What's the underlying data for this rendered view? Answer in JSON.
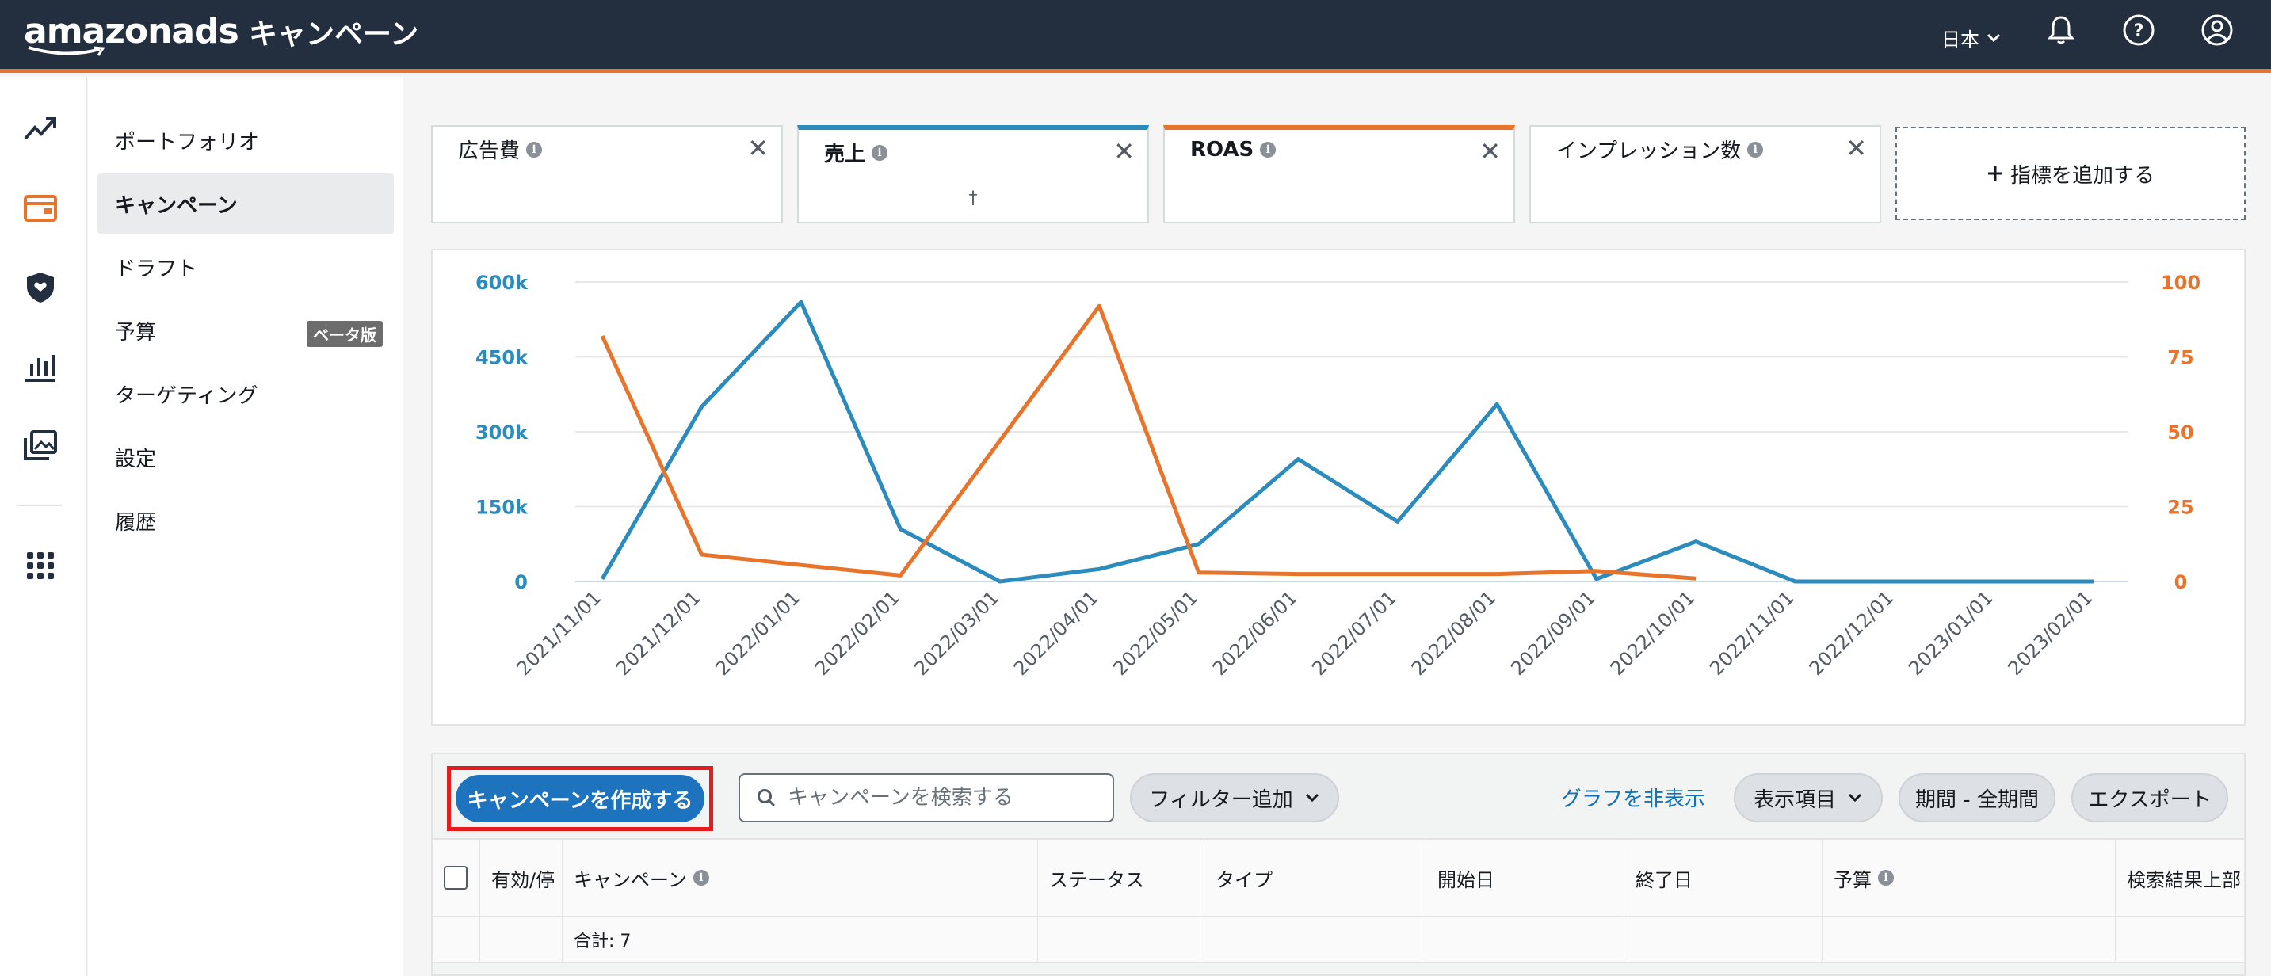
{
  "header": {
    "logo": "amazonads",
    "title": "キャンペーン",
    "language": "日本",
    "icons": [
      "bell-icon",
      "help-icon",
      "account-icon"
    ]
  },
  "rail": {
    "icons": [
      "trend-icon",
      "campaign-icon",
      "shield-icon",
      "bar-chart-icon",
      "media-icon",
      "apps-grid-icon"
    ]
  },
  "sidebar": {
    "items": [
      {
        "label": "ポートフォリオ"
      },
      {
        "label": "キャンペーン"
      },
      {
        "label": "ドラフト"
      },
      {
        "label": "予算",
        "badge": "ベータ版"
      },
      {
        "label": "ターゲティング"
      },
      {
        "label": "設定"
      },
      {
        "label": "履歴"
      }
    ]
  },
  "metrics": {
    "cards": [
      {
        "label": "広告費",
        "value": ""
      },
      {
        "label": "売上",
        "value": "†"
      },
      {
        "label": "ROAS",
        "value": ""
      },
      {
        "label": "インプレッション数",
        "value": ""
      }
    ],
    "add_label": "指標を追加する"
  },
  "colors": {
    "blue": "#2b8bbd",
    "orange": "#e8742c",
    "header_bg": "#232f3e",
    "primary_button": "#1e73be",
    "highlight_box": "#e61b1b"
  },
  "chart_data": {
    "type": "line",
    "x": [
      "2021/11/01",
      "2021/12/01",
      "2022/01/01",
      "2022/02/01",
      "2022/03/01",
      "2022/04/01",
      "2022/05/01",
      "2022/06/01",
      "2022/07/01",
      "2022/08/01",
      "2022/09/01",
      "2022/10/01",
      "2022/11/01",
      "2022/12/01",
      "2023/01/01",
      "2023/02/01"
    ],
    "left_ticks": [
      "0",
      "150k",
      "300k",
      "450k",
      "600k"
    ],
    "right_ticks": [
      "0",
      "25",
      "50",
      "75",
      "100"
    ],
    "ylim_left": [
      0,
      600000
    ],
    "ylim_right": [
      0,
      100
    ],
    "grid": true,
    "series": [
      {
        "axis": "left",
        "color": "#2b8bbd",
        "values": [
          5000,
          350000,
          560000,
          105000,
          0,
          25000,
          75000,
          245000,
          120000,
          355000,
          5000,
          80000,
          0,
          0,
          0,
          0
        ]
      },
      {
        "axis": "right",
        "color": "#e8742c",
        "values": [
          82,
          9,
          null,
          2,
          null,
          92,
          3,
          2.5,
          null,
          2.5,
          3.5,
          1
        ]
      }
    ]
  },
  "toolbar": {
    "create_label": "キャンペーンを作成する",
    "search_placeholder": "キャンペーンを検索する",
    "filter_label": "フィルター追加",
    "hide_graph_label": "グラフを非表示",
    "columns_label": "表示項目",
    "period_label": "期間 - 全期間",
    "export_label": "エクスポート"
  },
  "table": {
    "headers": [
      "有効/停",
      "キャンペーン",
      "ステータス",
      "タイプ",
      "開始日",
      "終了日",
      "予算",
      "検索結果上部"
    ],
    "total_label": "合計: 7"
  }
}
